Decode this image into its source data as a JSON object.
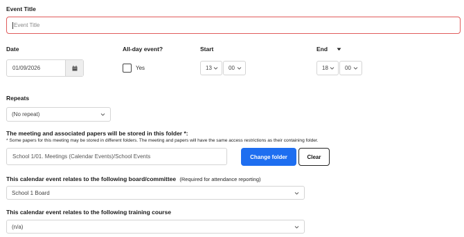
{
  "event_title": {
    "label": "Event Title",
    "placeholder": "Event Title"
  },
  "date": {
    "label": "Date",
    "value": "01/09/2026"
  },
  "all_day": {
    "label": "All-day event?",
    "option": "Yes"
  },
  "start": {
    "label": "Start",
    "hour": "13",
    "minute": "00"
  },
  "end": {
    "label": "End",
    "hour": "18",
    "minute": "00"
  },
  "repeats": {
    "label": "Repeats",
    "value": "(No repeat)"
  },
  "folder": {
    "label": "The meeting and associated papers will be stored in this folder *:",
    "note": "* Some papers for this meeting may be stored in different folders. The meeting and papers will have the same access restrictions as their containing folder.",
    "path": "School 1/01. Meetings (Calendar Events)/School Events",
    "change_label": "Change folder",
    "clear_label": "Clear"
  },
  "board": {
    "label": "This calendar event relates to the following board/committee",
    "hint": "(Required for attendance reporting)",
    "value": "School 1 Board"
  },
  "training": {
    "label": "This calendar event relates to the following training course",
    "value": "(n/a)"
  },
  "colors": {
    "accent": "#1e6ef0",
    "error_border": "#e05a5a"
  }
}
